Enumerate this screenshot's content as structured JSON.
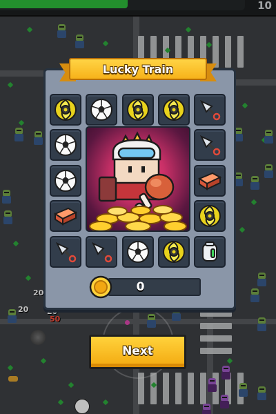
{
  "hud": {
    "xp_progress": 0.52,
    "level": "10"
  },
  "dialog": {
    "title": "Lucky Train",
    "reward_items": [
      "shuriken-icon",
      "soccer-ball-icon",
      "shuriken-icon",
      "shuriken-icon",
      "kunai-icon",
      "soccer-ball-icon",
      "kunai-icon",
      "soccer-ball-icon",
      "brick-icon",
      "brick-icon",
      "shuriken-icon",
      "kunai-icon",
      "kunai-icon",
      "soccer-ball-icon",
      "shuriken-icon",
      "jar-icon"
    ],
    "featured_item": "character-with-drumstick-and-gold",
    "coin_count": "0",
    "next_label": "Next"
  },
  "world": {
    "floating_numbers": [
      "20",
      "20",
      "20",
      "50"
    ]
  },
  "colors": {
    "accent_gold": "#f7b21a",
    "panel": "#8a96a8",
    "slot": "#323d4b",
    "xp_green": "#2fbf3c"
  }
}
